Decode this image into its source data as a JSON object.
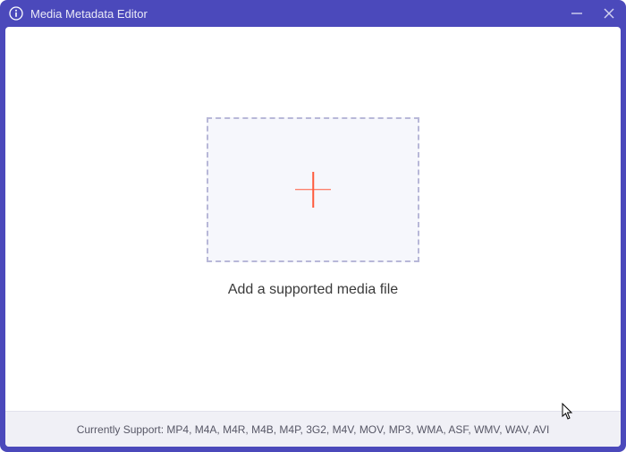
{
  "titlebar": {
    "title": "Media Metadata Editor"
  },
  "main": {
    "instruction": "Add a supported media file"
  },
  "footer": {
    "support_text": "Currently Support: MP4, M4A, M4R, M4B, M4P, 3G2, M4V, MOV, MP3, WMA, ASF, WMV, WAV, AVI"
  }
}
